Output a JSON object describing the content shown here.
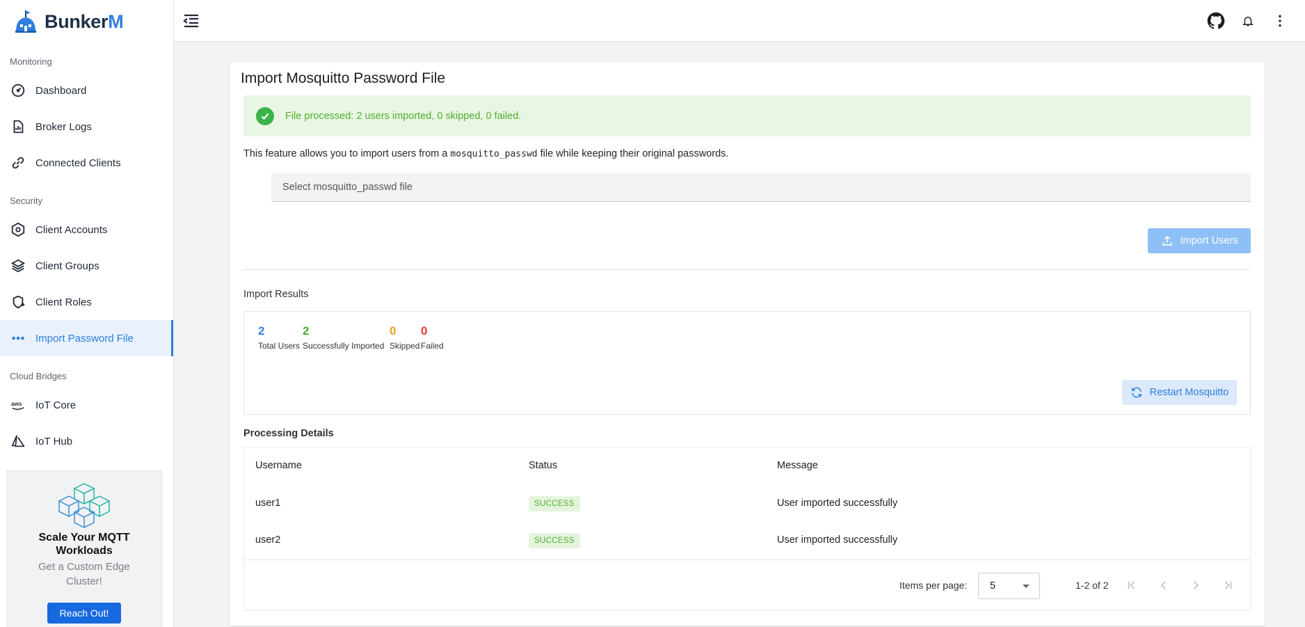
{
  "brand": {
    "part1": "Bunker",
    "part2": "M"
  },
  "sidebar": {
    "sections": [
      {
        "title": "Monitoring",
        "items": [
          {
            "label": "Dashboard",
            "icon": "dashboard-gauge-icon"
          },
          {
            "label": "Broker Logs",
            "icon": "log-file-icon"
          },
          {
            "label": "Connected Clients",
            "icon": "link-icon"
          }
        ]
      },
      {
        "title": "Security",
        "items": [
          {
            "label": "Client Accounts",
            "icon": "hexagon-icon"
          },
          {
            "label": "Client Groups",
            "icon": "layers-icon"
          },
          {
            "label": "Client Roles",
            "icon": "shield-plus-icon"
          },
          {
            "label": "Import Password File",
            "icon": "dots-icon",
            "active": true
          }
        ]
      },
      {
        "title": "Cloud Bridges",
        "items": [
          {
            "label": "IoT Core",
            "icon": "aws-icon"
          },
          {
            "label": "IoT Hub",
            "icon": "azure-icon"
          }
        ]
      }
    ],
    "promo": {
      "title": "Scale Your MQTT Workloads",
      "subtitle": "Get a Custom Edge Cluster!",
      "button": "Reach Out!"
    }
  },
  "topbar": {
    "icons": [
      "menu-collapse-icon",
      "github-icon",
      "bell-icon",
      "more-vertical-icon"
    ]
  },
  "main": {
    "title": "Import Mosquitto Password File",
    "alert": "File processed: 2 users imported, 0 skipped, 0 failed.",
    "description": {
      "before": "This feature allows you to import users from a ",
      "code": "mosquitto_passwd",
      "after": " file while keeping their original passwords."
    },
    "file_input_placeholder": "Select mosquitto_passwd file",
    "import_button": "Import Users",
    "results_title": "Import Results",
    "stats": [
      {
        "value": "2",
        "label": "Total Users",
        "color": "#2f7fdd"
      },
      {
        "value": "2",
        "label": "Successfully Imported",
        "color": "#4caf2e"
      },
      {
        "value": "0",
        "label": "Skipped",
        "color": "#f0a020"
      },
      {
        "value": "0",
        "label": "Failed",
        "color": "#e53935"
      }
    ],
    "restart_button": "Restart Mosquitto",
    "details_title": "Processing Details",
    "table": {
      "headers": [
        "Username",
        "Status",
        "Message"
      ],
      "rows": [
        {
          "username": "user1",
          "status": "SUCCESS",
          "message": "User imported successfully"
        },
        {
          "username": "user2",
          "status": "SUCCESS",
          "message": "User imported successfully"
        }
      ]
    },
    "pagination": {
      "items_per_page_label": "Items per page:",
      "items_per_page": "5",
      "range": "1-2 of 2"
    }
  },
  "colors": {
    "accent": "#2f7fdd",
    "success": "#4caf2e",
    "warning": "#f0a020",
    "danger": "#e53935"
  }
}
